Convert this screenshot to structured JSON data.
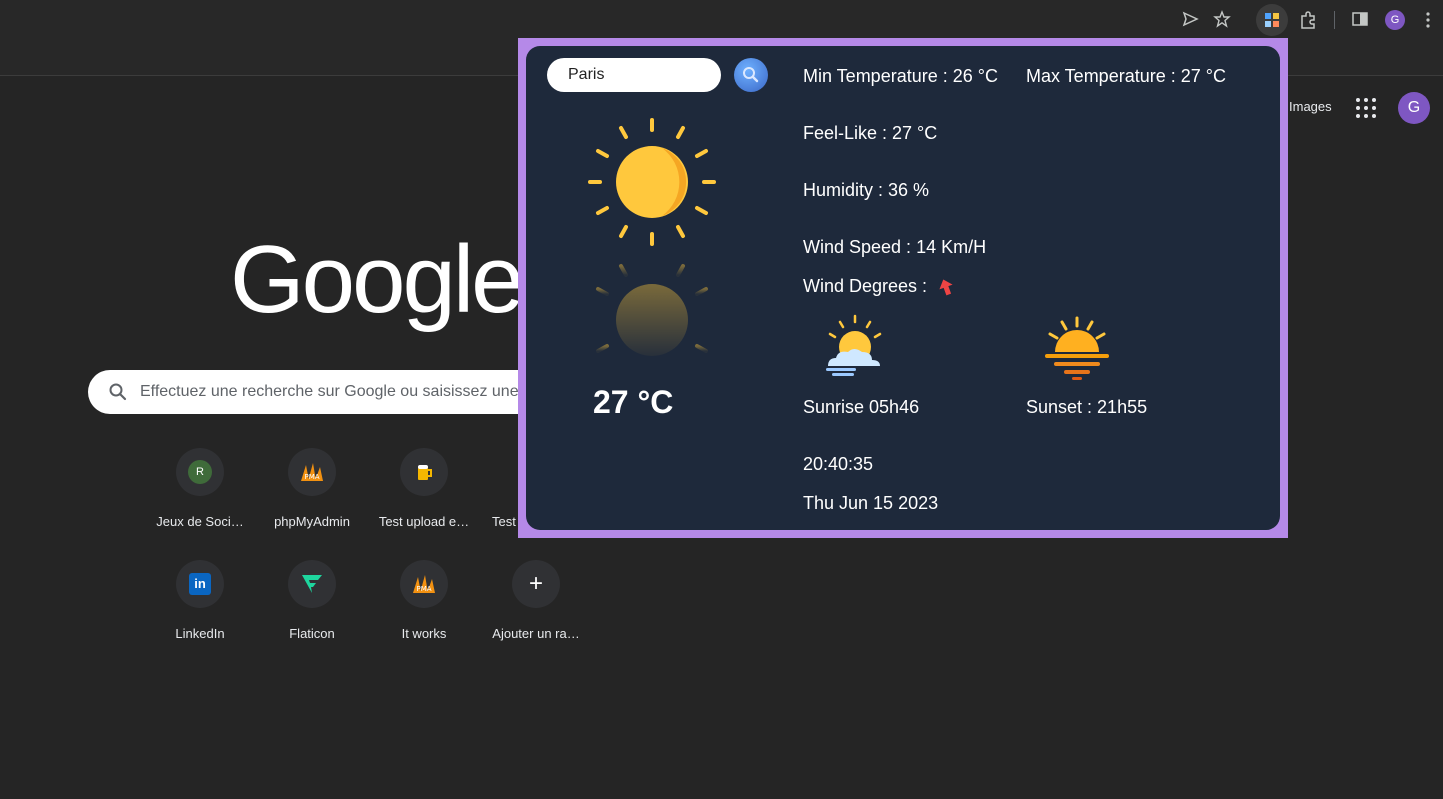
{
  "browser": {
    "profile_initial": "G"
  },
  "ntp": {
    "images_link": "Images",
    "avatar_initial": "G",
    "logo_text": "Google",
    "search_placeholder": "Effectuez une recherche sur Google ou saisissez une",
    "shortcuts": [
      {
        "label": "Jeux de Soci…",
        "initial": "R"
      },
      {
        "label": "phpMyAdmin"
      },
      {
        "label": "Test upload e…"
      },
      {
        "label": "Test"
      },
      {
        "label": "LinkedIn",
        "initial": "in"
      },
      {
        "label": "Flaticon"
      },
      {
        "label": "It works"
      },
      {
        "label": "Ajouter un ra…",
        "initial": "+"
      }
    ]
  },
  "weather": {
    "city_value": "Paris",
    "temperature": "27 °C",
    "min_temp": "Min Temperature : 26 °C",
    "max_temp": "Max Temperature : 27 °C",
    "feels_like": "Feel-Like : 27 °C",
    "humidity": "Humidity : 36 %",
    "wind_speed": "Wind Speed : 14 Km/H",
    "wind_degrees": "Wind Degrees :",
    "sunrise": "Sunrise 05h46",
    "sunset": "Sunset : 21h55",
    "time": "20:40:35",
    "date": "Thu Jun 15 2023"
  },
  "colors": {
    "popup_bg": "#1e293b",
    "popup_border": "#b589e8",
    "sun": "#ffc83d",
    "arrow": "#ef4444"
  }
}
